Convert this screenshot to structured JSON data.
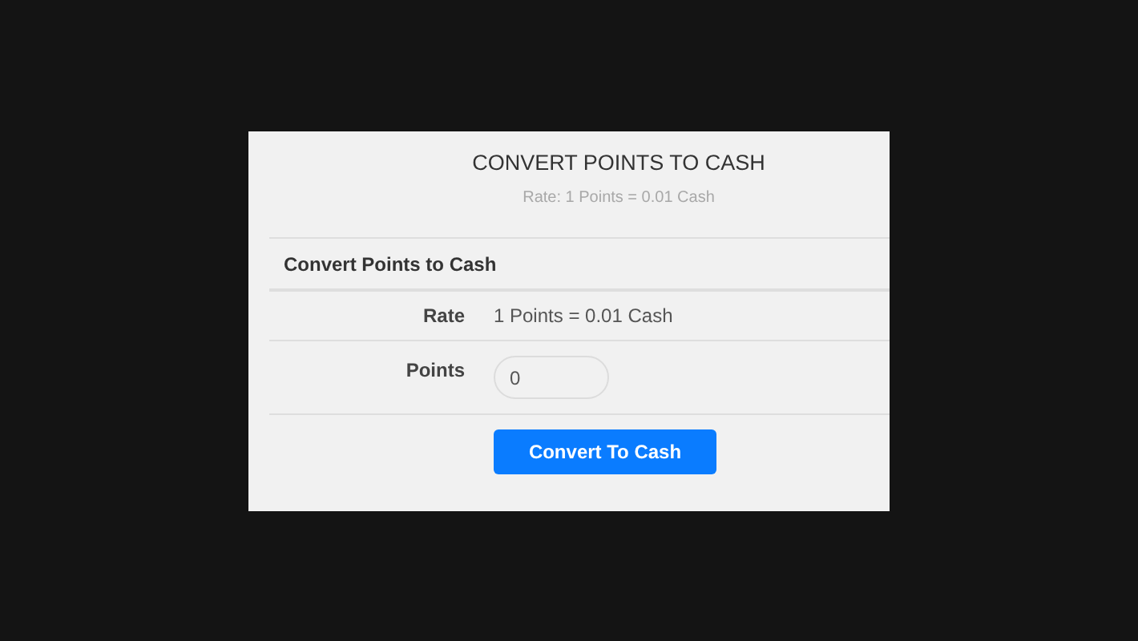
{
  "title": "CONVERT POINTS TO CASH",
  "subtitle": "Rate: 1 Points = 0.01 Cash",
  "section_heading": "Convert Points to Cash",
  "rate": {
    "label": "Rate",
    "value": "1 Points = 0.01 Cash"
  },
  "points": {
    "label": "Points",
    "value": "0"
  },
  "submit_button": "Convert To Cash"
}
